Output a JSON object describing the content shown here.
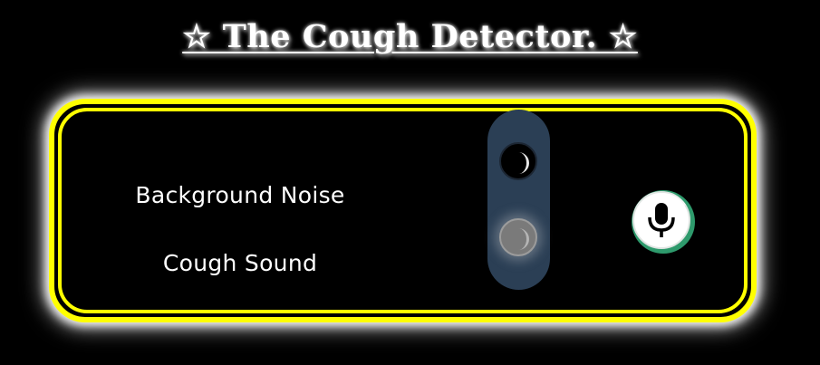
{
  "header": {
    "title": "☆ The Cough Detector. ☆"
  },
  "detector": {
    "labels": {
      "background_noise": "Background Noise",
      "cough_sound": "Cough Sound"
    },
    "toggle": {
      "options": [
        "Background Noise",
        "Cough Sound"
      ],
      "active": "Cough Sound"
    },
    "icons": {
      "top_knob": "crescent-moon-icon",
      "bottom_knob": "crescent-moon-icon",
      "mic": "microphone-icon"
    }
  },
  "colors": {
    "background": "#000000",
    "panel_border": "#ffff00",
    "panel_glow": "#ffffff",
    "slider_track": "#2b3f55",
    "mic_accent": "#2e9a6c",
    "text": "#ffffff"
  }
}
